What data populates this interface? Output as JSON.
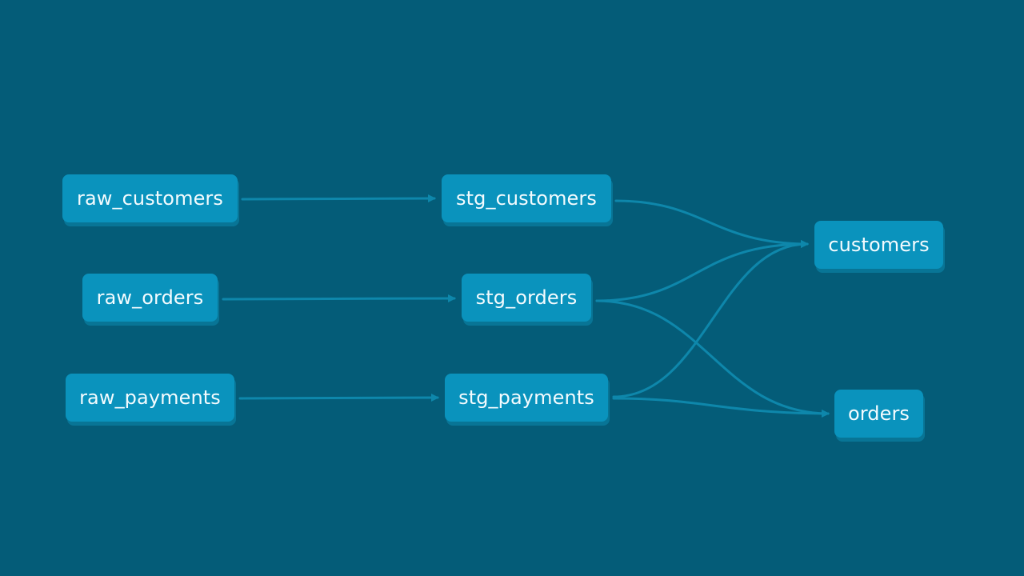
{
  "dag": {
    "nodes": {
      "raw_customers": "raw_customers",
      "raw_orders": "raw_orders",
      "raw_payments": "raw_payments",
      "stg_customers": "stg_customers",
      "stg_orders": "stg_orders",
      "stg_payments": "stg_payments",
      "customers": "customers",
      "orders": "orders"
    },
    "edges": [
      [
        "raw_customers",
        "stg_customers"
      ],
      [
        "raw_orders",
        "stg_orders"
      ],
      [
        "raw_payments",
        "stg_payments"
      ],
      [
        "stg_customers",
        "customers"
      ],
      [
        "stg_orders",
        "customers"
      ],
      [
        "stg_payments",
        "customers"
      ],
      [
        "stg_orders",
        "orders"
      ],
      [
        "stg_payments",
        "orders"
      ]
    ]
  },
  "colors": {
    "background": "#045c78",
    "node_fill": "#0a93bd",
    "node_shadow": "#087596",
    "node_text": "#f3fbfe",
    "edge": "#0e87ab"
  }
}
